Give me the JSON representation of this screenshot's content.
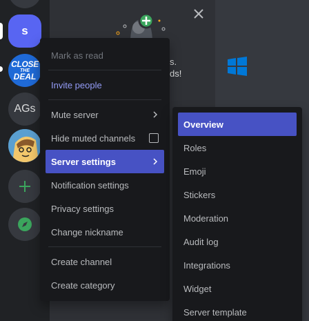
{
  "colors": {
    "accent": "#5865f2",
    "active_item": "#4752c4",
    "menu_bg": "#18191c",
    "rail_bg": "#202225",
    "green": "#3ba55d"
  },
  "rail": {
    "servers": [
      {
        "label": "s"
      },
      {
        "line1": "CLOSE",
        "line2": "THE",
        "line3": "DEAL"
      },
      {
        "label": "AGs"
      },
      {
        "icon": "avatar-image"
      },
      {
        "label": "+"
      },
      {
        "icon": "compass-icon"
      }
    ]
  },
  "welcome": {
    "frag1": "s.",
    "frag2": "ds!"
  },
  "context_menu": {
    "items": [
      {
        "label": "Mark as read"
      },
      {
        "label": "Invite people"
      },
      {
        "label": "Mute server"
      },
      {
        "label": "Hide muted channels"
      },
      {
        "label": "Server settings"
      },
      {
        "label": "Notification settings"
      },
      {
        "label": "Privacy settings"
      },
      {
        "label": "Change nickname"
      },
      {
        "label": "Create channel"
      },
      {
        "label": "Create category"
      }
    ]
  },
  "server_settings_submenu": {
    "items": [
      {
        "label": "Overview"
      },
      {
        "label": "Roles"
      },
      {
        "label": "Emoji"
      },
      {
        "label": "Stickers"
      },
      {
        "label": "Moderation"
      },
      {
        "label": "Audit log"
      },
      {
        "label": "Integrations"
      },
      {
        "label": "Widget"
      },
      {
        "label": "Server template"
      }
    ]
  }
}
